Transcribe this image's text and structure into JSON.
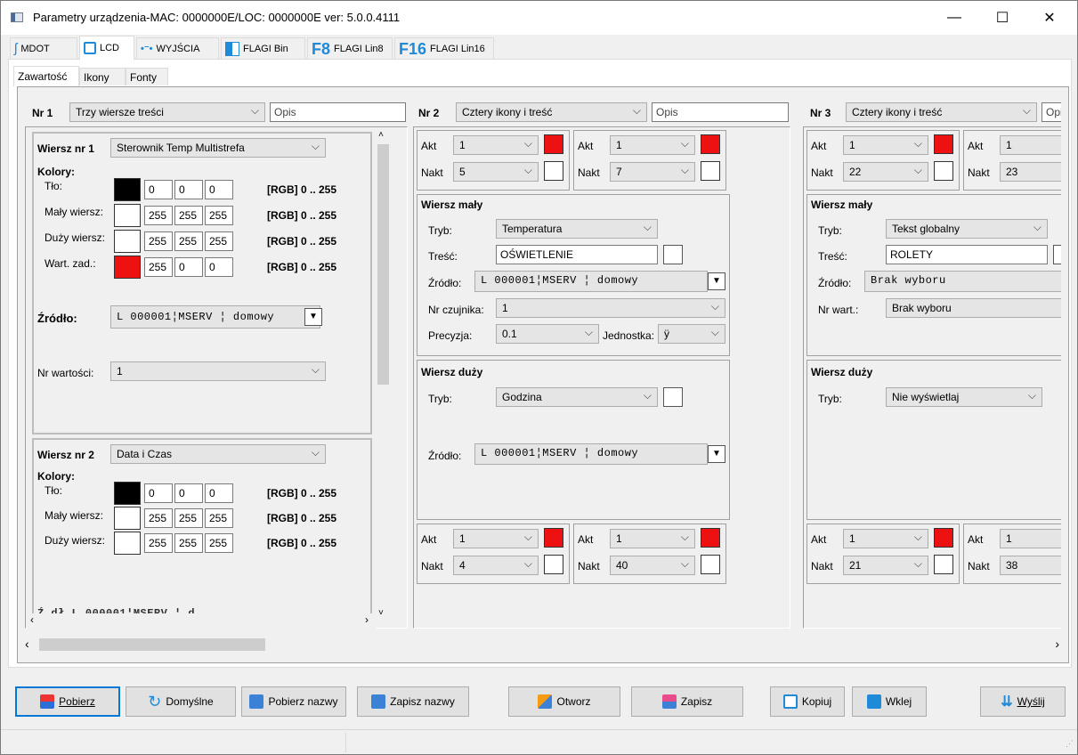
{
  "window": {
    "title": "Parametry urządzenia-MAC: 0000000E/LOC: 0000000E ver: 5.0.0.4111",
    "min": "—",
    "max": "☐",
    "close": "✕"
  },
  "tabs": [
    {
      "label": "MDOT"
    },
    {
      "label": "LCD"
    },
    {
      "label": "WYJŚCIA"
    },
    {
      "label": "FLAGI Bin"
    },
    {
      "label": "FLAGI Lin8",
      "icon_text": "F8"
    },
    {
      "label": "FLAGI Lin16",
      "icon_text": "F16"
    }
  ],
  "subtabs": [
    {
      "label": "Zawartość"
    },
    {
      "label": "Ikony"
    },
    {
      "label": "Fonty"
    }
  ],
  "colors": {
    "red": "#ee1111",
    "black": "#000000",
    "white": "#ffffff",
    "accent": "#0078d7"
  },
  "p1": {
    "nr": "Nr 1",
    "mode": "Trzy wiersze treści",
    "desc": "Opis",
    "row1": {
      "title": "Wiersz nr 1",
      "combo": "Sterownik Temp Multistrefa",
      "kolory": "Kolory:",
      "lines": [
        {
          "label": "Tło:",
          "r": "0",
          "g": "0",
          "b": "0",
          "rgb": "[RGB] 0 .. 255"
        },
        {
          "label": "Mały wiersz:",
          "r": "255",
          "g": "255",
          "b": "255",
          "rgb": "[RGB] 0 .. 255"
        },
        {
          "label": "Duży wiersz:",
          "r": "255",
          "g": "255",
          "b": "255",
          "rgb": "[RGB] 0 .. 255"
        },
        {
          "label": "Wart. zad.:",
          "r": "255",
          "g": "0",
          "b": "0",
          "rgb": "[RGB] 0 .. 255"
        }
      ],
      "zrodlo_label": "Źródło:",
      "zrodlo": "L 000001¦MSERV  ¦ domowy",
      "nrwart_label": "Nr wartości:",
      "nrwart": "1"
    },
    "row2": {
      "title": "Wiersz nr 2",
      "combo": "Data i Czas",
      "kolory": "Kolory:",
      "lines": [
        {
          "label": "Tło:",
          "r": "0",
          "g": "0",
          "b": "0",
          "rgb": "[RGB] 0 .. 255"
        },
        {
          "label": "Mały wiersz:",
          "r": "255",
          "g": "255",
          "b": "255",
          "rgb": "[RGB] 0 .. 255"
        },
        {
          "label": "Duży wiersz:",
          "r": "255",
          "g": "255",
          "b": "255",
          "rgb": "[RGB] 0 .. 255"
        }
      ],
      "partial": "Ź  dł    L 000001¦MSERV  ¦  d"
    }
  },
  "p2": {
    "nr": "Nr 2",
    "mode": "Cztery ikony i treść",
    "desc": "Opis",
    "akt_label": "Akt",
    "nakt_label": "Nakt",
    "top": {
      "akt1": "1",
      "nakt1": "5",
      "akt2": "1",
      "nakt2": "7"
    },
    "maly": {
      "title": "Wiersz mały",
      "tryb_label": "Tryb:",
      "tryb": "Temperatura",
      "tresc_label": "Treść:",
      "tresc": "OŚWIETLENIE",
      "zrodlo_label": "Źródło:",
      "zrodlo": "L 000001¦MSERV  ¦ domowy",
      "nrcz_label": "Nr czujnika:",
      "nrcz": "1",
      "prec_label": "Precyzja:",
      "prec": "0.1",
      "jedn_label": "Jednostka:",
      "jedn": "ÿ"
    },
    "duzy": {
      "title": "Wiersz duży",
      "tryb_label": "Tryb:",
      "tryb": "Godzina",
      "zrodlo_label": "Źródło:",
      "zrodlo": "L 000001¦MSERV  ¦ domowy"
    },
    "bottom": {
      "akt1": "1",
      "nakt1": "4",
      "akt2": "1",
      "nakt2": "40"
    }
  },
  "p3": {
    "nr": "Nr 3",
    "mode": "Cztery ikony i treść",
    "desc": "Opis",
    "akt_label": "Akt",
    "nakt_label": "Nakt",
    "top": {
      "akt1": "1",
      "nakt1": "22",
      "akt2": "1",
      "nakt2": "23"
    },
    "maly": {
      "title": "Wiersz mały",
      "tryb_label": "Tryb:",
      "tryb": "Tekst globalny",
      "tresc_label": "Treść:",
      "tresc": "ROLETY",
      "zrodlo_label": "Źródło:",
      "zrodlo": "Brak wyboru",
      "nrwart_label": "Nr wart.:",
      "nrwart": "Brak wyboru"
    },
    "duzy": {
      "title": "Wiersz duży",
      "tryb_label": "Tryb:",
      "tryb": "Nie wyświetlaj"
    },
    "bottom": {
      "akt1": "1",
      "nakt1": "21",
      "akt2": "1",
      "nakt2": "38"
    }
  },
  "buttons": {
    "pobierz": "Pobierz",
    "domyslne": "Domyślne",
    "pobierz_nazwy": "Pobierz nazwy",
    "zapisz_nazwy": "Zapisz nazwy",
    "otworz": "Otworz",
    "zapisz": "Zapisz",
    "kopiuj": "Kopiuj",
    "wklej": "Wklej",
    "wyslij": "Wyślij"
  }
}
